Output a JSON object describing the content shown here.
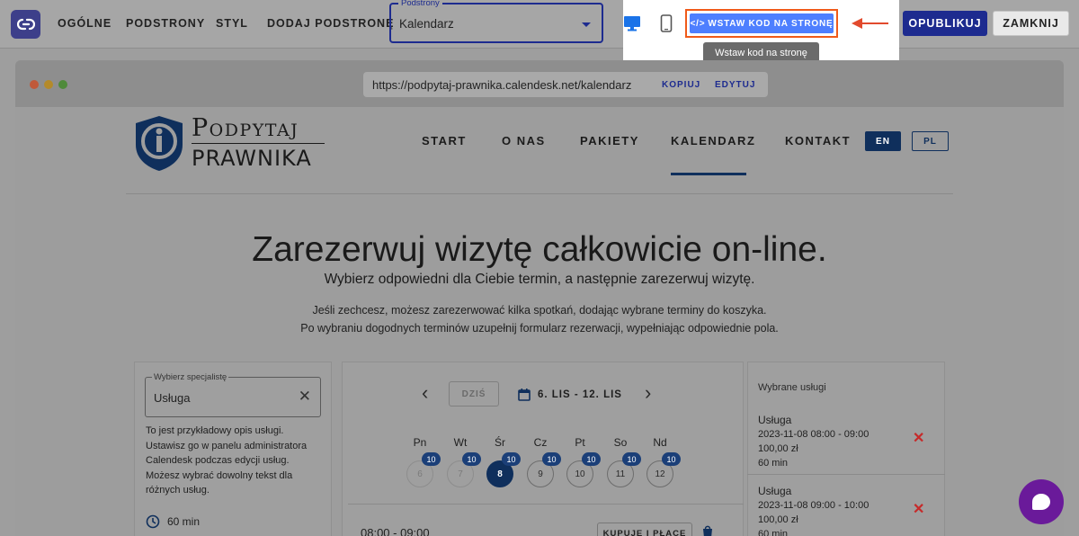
{
  "toolbar": {
    "menu": [
      "OGÓLNE",
      "PODSTRONY",
      "STYL",
      "DODAJ PODSTRONĘ"
    ],
    "page_select": {
      "legend": "Podstrony",
      "value": "Kalendarz"
    },
    "embed_button": "WSTAW KOD NA STRONĘ",
    "tooltip": "Wstaw kod na stronę",
    "publish": "OPUBLIKUJ",
    "close": "ZAMKNIJ"
  },
  "browser": {
    "url": "https://podpytaj-prawnika.calendesk.net/kalendarz",
    "copy": "KOPIUJ",
    "edit": "EDYTUJ"
  },
  "site": {
    "logo_line1": "Podpytaj",
    "logo_line2": "PRAWNIKA",
    "nav": [
      "START",
      "O NAS",
      "PAKIETY",
      "KALENDARZ",
      "KONTAKT"
    ],
    "lang": [
      "EN",
      "PL"
    ]
  },
  "hero": {
    "title": "Zarezerwuj wizytę całkowicie on-line.",
    "subtitle": "Wybierz odpowiedni dla Ciebie termin, a następnie zarezerwuj wizytę.",
    "info1": "Jeśli zechcesz, możesz zarezerwować kilka spotkań, dodając wybrane terminy do koszyka.",
    "info2": "Po wybraniu dogodnych terminów uzupełnij formularz rezerwacji, wypełniając odpowiednie pola."
  },
  "specialist": {
    "legend": "Wybierz specjalistę",
    "value": "Usługa",
    "description": "To jest przykładowy opis usługi. Ustawisz go w panelu administratora Calendesk podczas edycji usług. Możesz wybrać dowolny tekst dla różnych usług.",
    "duration": "60 min"
  },
  "calendar": {
    "today": "DZIŚ",
    "range": "6. LIS - 12. LIS",
    "days": [
      {
        "label": "Pn",
        "num": "6",
        "badge": "10",
        "state": "past"
      },
      {
        "label": "Wt",
        "num": "7",
        "badge": "10",
        "state": "past"
      },
      {
        "label": "Śr",
        "num": "8",
        "badge": "10",
        "state": "selected"
      },
      {
        "label": "Cz",
        "num": "9",
        "badge": "10",
        "state": "normal"
      },
      {
        "label": "Pt",
        "num": "10",
        "badge": "10",
        "state": "normal"
      },
      {
        "label": "So",
        "num": "11",
        "badge": "10",
        "state": "normal"
      },
      {
        "label": "Nd",
        "num": "12",
        "badge": "10",
        "state": "normal"
      }
    ],
    "slot_time": "08:00 - 09:00",
    "buy": "KUPUJĘ I PŁACĘ"
  },
  "selected": {
    "title": "Wybrane usługi",
    "items": [
      {
        "name": "Usługa",
        "datetime": "2023-11-08 08:00 - 09:00",
        "price": "100,00 zł",
        "duration": "60 min"
      },
      {
        "name": "Usługa",
        "datetime": "2023-11-08 09:00 - 10:00",
        "price": "100,00 zł",
        "duration": "60 min"
      }
    ]
  }
}
